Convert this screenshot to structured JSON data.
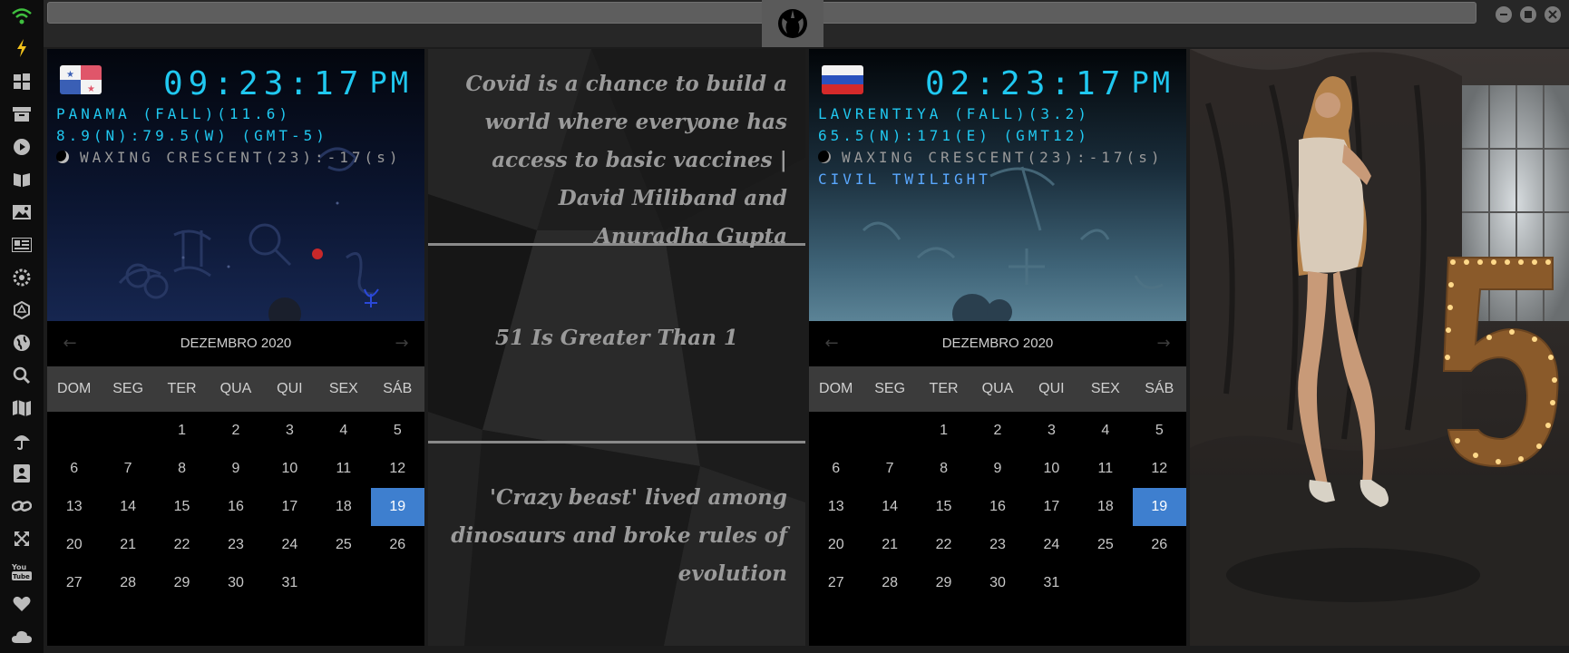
{
  "sidebar": {
    "icons": [
      "wifi-icon",
      "bolt-icon",
      "windows-icon",
      "archive-icon",
      "play-icon",
      "book-icon",
      "image-icon",
      "news-icon",
      "settings-icon",
      "hexagon-icon",
      "globe-icon",
      "search-icon",
      "map-icon",
      "umbrella-icon",
      "contact-icon",
      "link-icon",
      "expand-icon",
      "youtube-icon",
      "heart-icon",
      "cloud-icon"
    ]
  },
  "left_clock": {
    "time": "09:23:17",
    "ampm": "PM",
    "location_line": "PANAMA (FALL)(11.6)",
    "coords_line": "8.9(N):79.5(W) (GMT-5)",
    "moon_line": "WAXING CRESCENT(23):-17(s)"
  },
  "right_clock": {
    "time": "02:23:17",
    "ampm": "PM",
    "location_line": "LAVRENTIYA (FALL)(3.2)",
    "coords_line": "65.5(N):171(E) (GMT12)",
    "moon_line": "WAXING CRESCENT(23):-17(s)",
    "twilight_line": "CIVIL TWILIGHT"
  },
  "calendar": {
    "title": "DEZEMBRO 2020",
    "weekdays": [
      "DOM",
      "SEG",
      "TER",
      "QUA",
      "QUI",
      "SEX",
      "SÁB"
    ],
    "first_weekday_index": 2,
    "days_in_month": 31,
    "today": 19
  },
  "quotes": {
    "q1": "Covid is a chance to build a world where everyone has access to basic vaccines | David Miliband and Anuradha Gupta",
    "q2": "51 Is Greater Than 1",
    "q3": "'Crazy beast' lived among dinosaurs and broke rules of evolution"
  },
  "colors": {
    "clock": "#20c8f0",
    "today_highlight": "#3e7fcf",
    "twilight": "#5aa8ff"
  }
}
